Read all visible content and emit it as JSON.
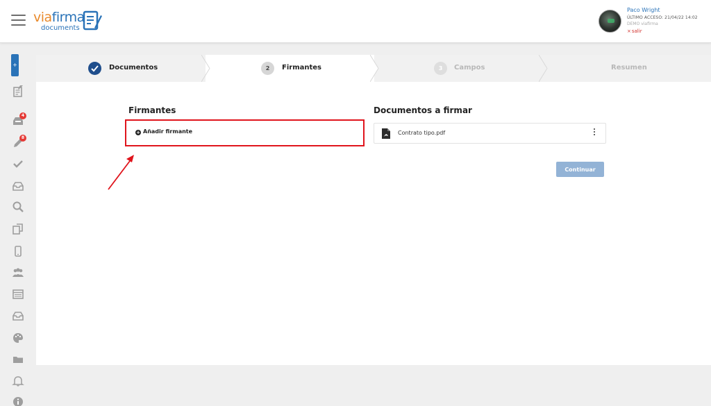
{
  "header": {
    "logo": {
      "via": "via",
      "firma": "firma",
      "documents": "documents"
    },
    "user": {
      "name": "Paco Wright",
      "last_access": "ÚLTIMO ACCESO: 21/04/22 14:02",
      "organization": "DEMO viafirma",
      "logout_label": "salir"
    }
  },
  "sidebar": {
    "add_label": "+",
    "icons": [
      "edit-document-icon",
      "inbox-icon",
      "pen-icon",
      "check-icon",
      "tray-icon",
      "search-icon",
      "copy-icon",
      "mobile-icon",
      "users-icon",
      "template-icon",
      "archive-icon",
      "palette-icon",
      "folder-icon",
      "bell-icon",
      "info-icon"
    ],
    "badges": {
      "inbox": "4",
      "pen": "8"
    }
  },
  "wizard": {
    "steps": [
      {
        "number": "✓",
        "label": "Documentos",
        "state": "completed"
      },
      {
        "number": "2",
        "label": "Firmantes",
        "state": "active"
      },
      {
        "number": "3",
        "label": "Campos",
        "state": "disabled"
      },
      {
        "number": "",
        "label": "Resumen",
        "state": "disabled"
      }
    ]
  },
  "signers": {
    "title": "Firmantes",
    "add_label": "Añadir firmante"
  },
  "documents": {
    "title": "Documentos a firmar",
    "items": [
      {
        "name": "Contrato tipo.pdf"
      }
    ]
  },
  "actions": {
    "continue_label": "Continuar"
  },
  "colors": {
    "brand_blue": "#2a73b8",
    "brand_orange": "#e98a2c",
    "highlight_red": "#e0141c",
    "badge_red": "#e53935",
    "continue_disabled": "#93b3d6"
  }
}
